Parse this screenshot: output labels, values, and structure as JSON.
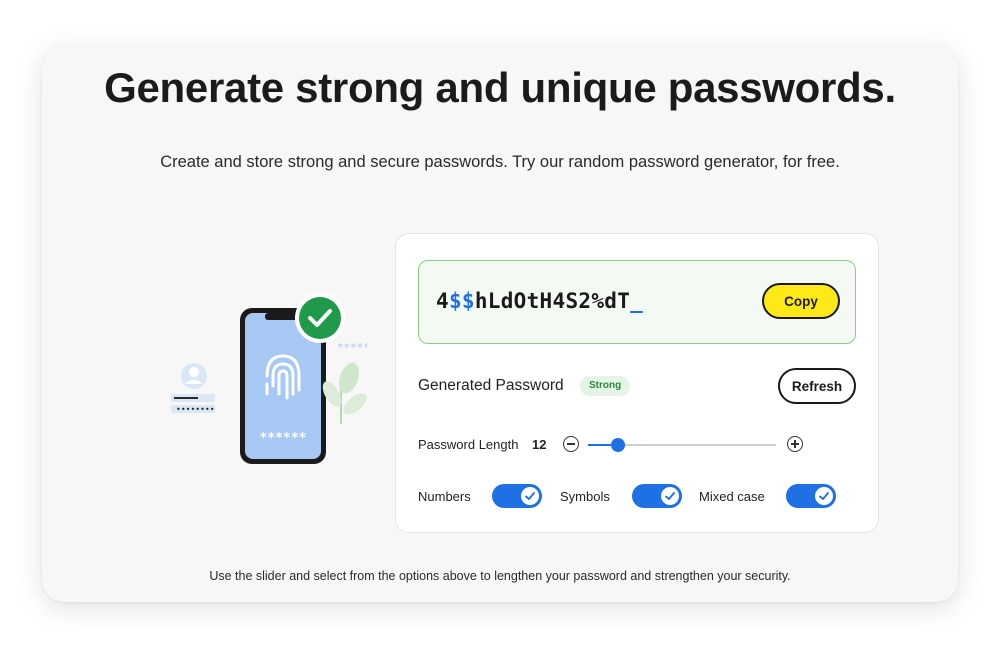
{
  "header": {
    "title": "Generate strong and unique passwords.",
    "subtitle": "Create and store strong and secure passwords. Try our random password generator, for free."
  },
  "illustration": {
    "masked_password_phone": "******",
    "masked_password_side": "*****"
  },
  "generator": {
    "password": {
      "part1": "4",
      "symbols": "$$",
      "part2": "hLdOtH4S2%dT",
      "cursor": "_"
    },
    "copy_label": "Copy",
    "generated_label": "Generated Password",
    "strength": "Strong",
    "refresh_label": "Refresh",
    "length_label": "Password Length",
    "length_value": "12",
    "slider_fraction": 0.16,
    "options": [
      {
        "label": "Numbers",
        "checked": true
      },
      {
        "label": "Symbols",
        "checked": true
      },
      {
        "label": "Mixed case",
        "checked": true
      }
    ]
  },
  "footer": {
    "text": "Use the slider and select from the options above to lengthen your password and strengthen your security."
  },
  "colors": {
    "accent": "#1f6fe5",
    "copy_button": "#ffe817",
    "success": "#2d8a3a",
    "password_box_border": "#86cf8c"
  }
}
